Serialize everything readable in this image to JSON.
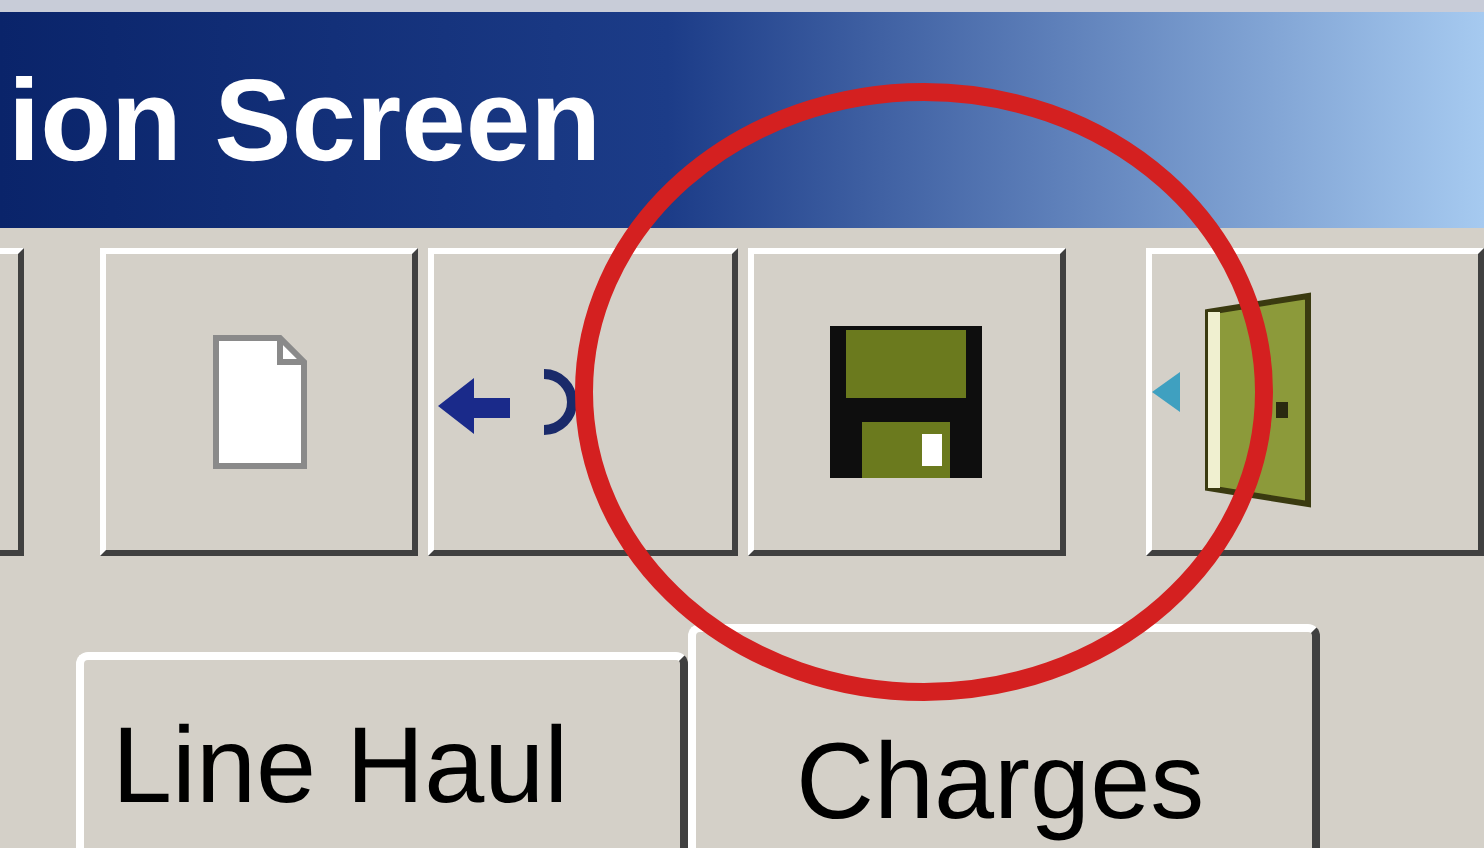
{
  "window": {
    "title": "ion Screen"
  },
  "toolbar": {
    "buttons": [
      {
        "kind": "partial"
      },
      {
        "kind": "new"
      },
      {
        "kind": "back"
      },
      {
        "kind": "save"
      },
      {
        "kind": "exit"
      }
    ]
  },
  "tabs": [
    {
      "label": "Line Haul",
      "selected": false
    },
    {
      "label": "Charges",
      "selected": true
    }
  ]
}
